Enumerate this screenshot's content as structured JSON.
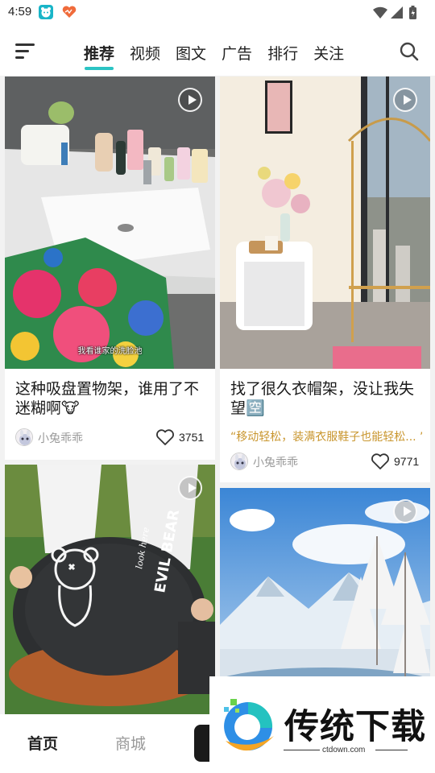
{
  "status_bar": {
    "time": "4:59",
    "icons": [
      "app-bear-icon",
      "app-heart-icon",
      "wifi-icon",
      "signal-icon",
      "battery-icon"
    ]
  },
  "nav": {
    "menu_icon": "menu-icon",
    "tabs": [
      {
        "label": "推荐",
        "active": true
      },
      {
        "label": "视频",
        "active": false
      },
      {
        "label": "图文",
        "active": false
      },
      {
        "label": "广告",
        "active": false
      },
      {
        "label": "排行",
        "active": false
      },
      {
        "label": "关注",
        "active": false
      }
    ],
    "search_icon": "search-icon",
    "accent_color": "#2bc4c4"
  },
  "feed": {
    "cards": [
      {
        "title": "这种吸盘置物架，谁用了不迷糊啊🐮",
        "subtitle": "我看谁家的洗脸池",
        "author": "小兔乖乖",
        "likes": "3751",
        "media": "video"
      },
      {
        "title": "找了很久衣帽架，没让我失望🈳",
        "quote": "“移动轻松，装满衣服鞋子也能轻松... ”",
        "author": "小兔乖乖",
        "likes": "9771",
        "media": "video"
      },
      {
        "title": "",
        "author": "",
        "likes": "",
        "media": "video",
        "image_text": [
          "look here",
          "EVIL BEAR"
        ]
      },
      {
        "title": "",
        "author": "",
        "likes": "",
        "media": "video"
      }
    ]
  },
  "bottom_nav": {
    "items": [
      {
        "label": "首页",
        "active": true
      },
      {
        "label": "商城",
        "active": false
      }
    ]
  },
  "watermark": {
    "brand": "传统下载",
    "url": "ctdown.com"
  }
}
